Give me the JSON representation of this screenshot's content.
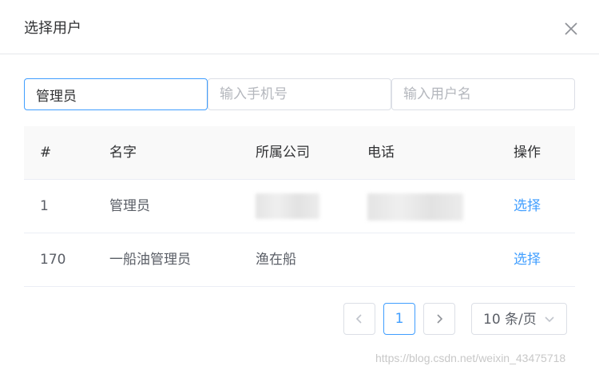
{
  "dialog": {
    "title": "选择用户",
    "close_icon": "close-icon"
  },
  "filters": {
    "name": {
      "value": "管理员",
      "placeholder": "输入姓名"
    },
    "phone": {
      "value": "",
      "placeholder": "输入手机号"
    },
    "username": {
      "value": "",
      "placeholder": "输入用户名"
    }
  },
  "table": {
    "headers": [
      "#",
      "名字",
      "所属公司",
      "电话",
      "操作"
    ],
    "rows": [
      {
        "index": "1",
        "name": "管理员",
        "company": "",
        "phone": "",
        "action": "选择",
        "company_redacted": true,
        "phone_redacted": true
      },
      {
        "index": "170",
        "name": "一船油管理员",
        "company": "渔在船",
        "phone": "",
        "action": "选择"
      }
    ]
  },
  "pagination": {
    "prev_icon": "chevron-left-icon",
    "current_page": "1",
    "next_icon": "chevron-right-icon",
    "page_size": "10 条/页",
    "page_size_icon": "chevron-down-icon"
  },
  "watermark": "https://blog.csdn.net/weixin_43475718",
  "colors": {
    "accent": "#409eff",
    "border": "#dcdfe6",
    "header_bg": "#f9f9f9"
  }
}
